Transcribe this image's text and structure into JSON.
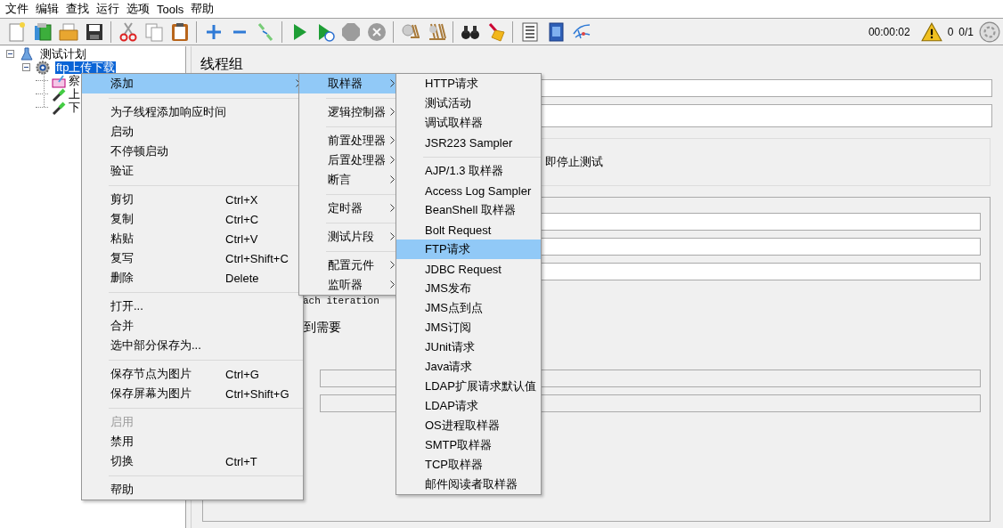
{
  "menu_bar": [
    "文件",
    "编辑",
    "查找",
    "运行",
    "选项",
    "Tools",
    "帮助"
  ],
  "toolbar": [
    {
      "kind": "new",
      "disabled": false
    },
    {
      "kind": "templates",
      "disabled": false
    },
    {
      "kind": "open",
      "disabled": false
    },
    {
      "kind": "save",
      "disabled": false
    },
    {
      "kind": "separator"
    },
    {
      "kind": "cut",
      "disabled": false
    },
    {
      "kind": "copy",
      "disabled": false
    },
    {
      "kind": "paste",
      "disabled": false
    },
    {
      "kind": "separator"
    },
    {
      "kind": "expand",
      "disabled": false
    },
    {
      "kind": "collapse",
      "disabled": false
    },
    {
      "kind": "toggle",
      "disabled": false
    },
    {
      "kind": "separator"
    },
    {
      "kind": "start",
      "disabled": false
    },
    {
      "kind": "start-no-pause",
      "disabled": false
    },
    {
      "kind": "stop",
      "disabled": true
    },
    {
      "kind": "shutdown",
      "disabled": true
    },
    {
      "kind": "separator"
    },
    {
      "kind": "clear",
      "disabled": false
    },
    {
      "kind": "clear-all",
      "disabled": false
    },
    {
      "kind": "separator"
    },
    {
      "kind": "search",
      "disabled": false
    },
    {
      "kind": "reset",
      "disabled": false
    },
    {
      "kind": "separator"
    },
    {
      "kind": "functions",
      "disabled": false
    },
    {
      "kind": "help",
      "disabled": false
    },
    {
      "kind": "logger",
      "disabled": false
    }
  ],
  "status": {
    "elapsed": "00:00:02",
    "warnings": "0",
    "threads": "0/1"
  },
  "tree": [
    {
      "label": "测试计划",
      "kind": "plan",
      "expanded": true,
      "selected": false,
      "children": [
        {
          "label": "ftp上传下载",
          "kind": "thread-group",
          "expanded": true,
          "selected": true,
          "children": [
            {
              "label": "察",
              "kind": "listener",
              "selected": false
            },
            {
              "label": "上",
              "kind": "sampler",
              "selected": false
            },
            {
              "label": "下",
              "kind": "sampler",
              "selected": false
            }
          ]
        }
      ]
    }
  ],
  "editor": {
    "title": "线程组",
    "fields": [
      {
        "disabled": false
      },
      {
        "disabled": false
      }
    ],
    "section_text": "即停止测试",
    "group": {
      "fields_top": [
        {
          "disabled": false
        },
        {
          "disabled": false
        },
        {
          "disabled": false
        }
      ],
      "iteration_text": "ach iteration",
      "schedule_text": "到需要",
      "fields_bottom": [
        {
          "disabled": true
        },
        {
          "disabled": true
        }
      ]
    }
  },
  "context_menu": {
    "items": [
      {
        "kind": "item",
        "label": "添加",
        "selected": true,
        "disabled": false,
        "submenu": true
      },
      {
        "kind": "separator"
      },
      {
        "kind": "item",
        "label": "为子线程添加响应时间",
        "selected": false,
        "disabled": false,
        "submenu": false
      },
      {
        "kind": "item",
        "label": "启动",
        "selected": false,
        "disabled": false,
        "submenu": false
      },
      {
        "kind": "item",
        "label": "不停顿启动",
        "selected": false,
        "disabled": false,
        "submenu": false
      },
      {
        "kind": "item",
        "label": "验证",
        "selected": false,
        "disabled": false,
        "submenu": false
      },
      {
        "kind": "separator"
      },
      {
        "kind": "item",
        "label": "剪切",
        "shortcut": "Ctrl+X",
        "selected": false,
        "disabled": false,
        "submenu": false
      },
      {
        "kind": "item",
        "label": "复制",
        "shortcut": "Ctrl+C",
        "selected": false,
        "disabled": false,
        "submenu": false
      },
      {
        "kind": "item",
        "label": "粘贴",
        "shortcut": "Ctrl+V",
        "selected": false,
        "disabled": false,
        "submenu": false
      },
      {
        "kind": "item",
        "label": "复写",
        "shortcut": "Ctrl+Shift+C",
        "selected": false,
        "disabled": false,
        "submenu": false
      },
      {
        "kind": "item",
        "label": "删除",
        "shortcut": "Delete",
        "selected": false,
        "disabled": false,
        "submenu": false
      },
      {
        "kind": "separator"
      },
      {
        "kind": "item",
        "label": "打开...",
        "selected": false,
        "disabled": false,
        "submenu": false
      },
      {
        "kind": "item",
        "label": "合并",
        "selected": false,
        "disabled": false,
        "submenu": false
      },
      {
        "kind": "item",
        "label": "选中部分保存为...",
        "selected": false,
        "disabled": false,
        "submenu": false
      },
      {
        "kind": "separator"
      },
      {
        "kind": "item",
        "label": "保存节点为图片",
        "shortcut": "Ctrl+G",
        "selected": false,
        "disabled": false,
        "submenu": false
      },
      {
        "kind": "item",
        "label": "保存屏幕为图片",
        "shortcut": "Ctrl+Shift+G",
        "selected": false,
        "disabled": false,
        "submenu": false
      },
      {
        "kind": "separator"
      },
      {
        "kind": "item",
        "label": "启用",
        "selected": false,
        "disabled": true,
        "submenu": false
      },
      {
        "kind": "item",
        "label": "禁用",
        "selected": false,
        "disabled": false,
        "submenu": false
      },
      {
        "kind": "item",
        "label": "切换",
        "shortcut": "Ctrl+T",
        "selected": false,
        "disabled": false,
        "submenu": false
      },
      {
        "kind": "separator"
      },
      {
        "kind": "item",
        "label": "帮助",
        "selected": false,
        "disabled": false,
        "submenu": false
      }
    ],
    "submenu": {
      "items": [
        {
          "kind": "item",
          "label": "取样器",
          "selected": true,
          "disabled": false,
          "submenu": true
        },
        {
          "kind": "separator"
        },
        {
          "kind": "item",
          "label": "逻辑控制器",
          "selected": false,
          "disabled": false,
          "submenu": true
        },
        {
          "kind": "separator"
        },
        {
          "kind": "item",
          "label": "前置处理器",
          "selected": false,
          "disabled": false,
          "submenu": true
        },
        {
          "kind": "item",
          "label": "后置处理器",
          "selected": false,
          "disabled": false,
          "submenu": true
        },
        {
          "kind": "item",
          "label": "断言",
          "selected": false,
          "disabled": false,
          "submenu": true
        },
        {
          "kind": "separator"
        },
        {
          "kind": "item",
          "label": "定时器",
          "selected": false,
          "disabled": false,
          "submenu": true
        },
        {
          "kind": "separator"
        },
        {
          "kind": "item",
          "label": "测试片段",
          "selected": false,
          "disabled": false,
          "submenu": true
        },
        {
          "kind": "separator"
        },
        {
          "kind": "item",
          "label": "配置元件",
          "selected": false,
          "disabled": false,
          "submenu": true
        },
        {
          "kind": "item",
          "label": "监听器",
          "selected": false,
          "disabled": false,
          "submenu": true
        }
      ],
      "submenu": {
        "items": [
          {
            "kind": "item",
            "label": "HTTP请求",
            "selected": false,
            "disabled": false,
            "submenu": false
          },
          {
            "kind": "item",
            "label": "测试活动",
            "selected": false,
            "disabled": false,
            "submenu": false
          },
          {
            "kind": "item",
            "label": "调试取样器",
            "selected": false,
            "disabled": false,
            "submenu": false
          },
          {
            "kind": "item",
            "label": "JSR223 Sampler",
            "selected": false,
            "disabled": false,
            "submenu": false
          },
          {
            "kind": "separator"
          },
          {
            "kind": "item",
            "label": "AJP/1.3 取样器",
            "selected": false,
            "disabled": false,
            "submenu": false
          },
          {
            "kind": "item",
            "label": "Access Log Sampler",
            "selected": false,
            "disabled": false,
            "submenu": false
          },
          {
            "kind": "item",
            "label": "BeanShell 取样器",
            "selected": false,
            "disabled": false,
            "submenu": false
          },
          {
            "kind": "item",
            "label": "Bolt Request",
            "selected": false,
            "disabled": false,
            "submenu": false
          },
          {
            "kind": "item",
            "label": "FTP请求",
            "selected": true,
            "disabled": false,
            "submenu": false
          },
          {
            "kind": "item",
            "label": "JDBC Request",
            "selected": false,
            "disabled": false,
            "submenu": false
          },
          {
            "kind": "item",
            "label": "JMS发布",
            "selected": false,
            "disabled": false,
            "submenu": false
          },
          {
            "kind": "item",
            "label": "JMS点到点",
            "selected": false,
            "disabled": false,
            "submenu": false
          },
          {
            "kind": "item",
            "label": "JMS订阅",
            "selected": false,
            "disabled": false,
            "submenu": false
          },
          {
            "kind": "item",
            "label": "JUnit请求",
            "selected": false,
            "disabled": false,
            "submenu": false
          },
          {
            "kind": "item",
            "label": "Java请求",
            "selected": false,
            "disabled": false,
            "submenu": false
          },
          {
            "kind": "item",
            "label": "LDAP扩展请求默认值",
            "selected": false,
            "disabled": false,
            "submenu": false
          },
          {
            "kind": "item",
            "label": "LDAP请求",
            "selected": false,
            "disabled": false,
            "submenu": false
          },
          {
            "kind": "item",
            "label": "OS进程取样器",
            "selected": false,
            "disabled": false,
            "submenu": false
          },
          {
            "kind": "item",
            "label": "SMTP取样器",
            "selected": false,
            "disabled": false,
            "submenu": false
          },
          {
            "kind": "item",
            "label": "TCP取样器",
            "selected": false,
            "disabled": false,
            "submenu": false
          },
          {
            "kind": "item",
            "label": "邮件阅读者取样器",
            "selected": false,
            "disabled": false,
            "submenu": false
          }
        ]
      }
    }
  }
}
